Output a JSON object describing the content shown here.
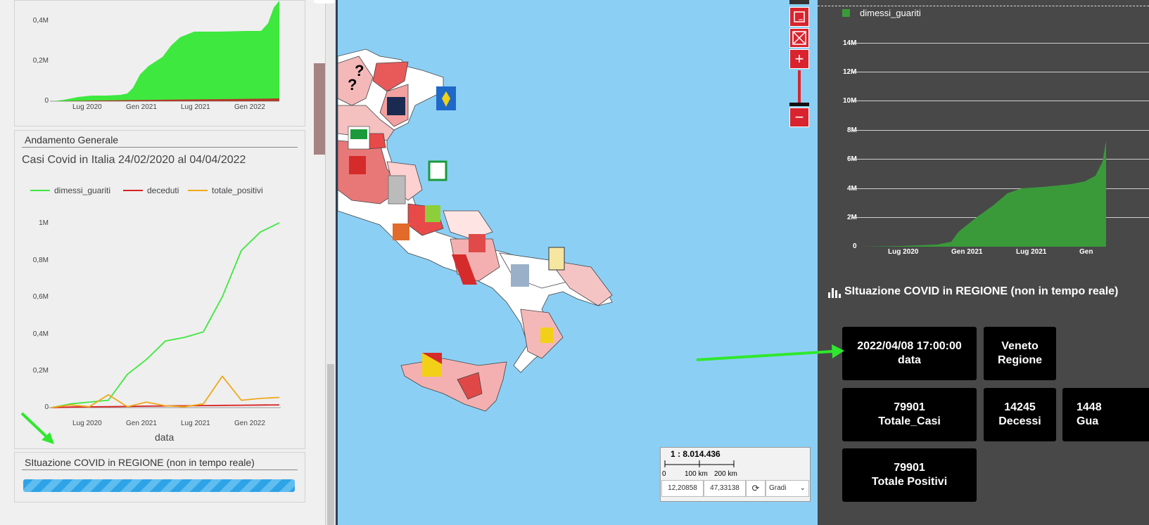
{
  "left": {
    "top_chart": {
      "yticks": [
        "0,4M",
        "0,2M",
        "0"
      ],
      "xticks": [
        "Lug 2020",
        "Gen 2021",
        "Lug 2021",
        "Gen 2022"
      ]
    },
    "general_card": {
      "title": "Andamento Generale",
      "chart_title": "Casi Covid in Italia 24/02/2020 al 04/04/2022"
    },
    "region_card": {
      "title": "SItuazione COVID in REGIONE (non in tempo reale)"
    }
  },
  "chart_data": [
    {
      "type": "area",
      "x": [
        "2020-02",
        "2020-07",
        "2021-01",
        "2021-07",
        "2022-01",
        "2022-04"
      ],
      "series": [
        {
          "name": "",
          "values": [
            0,
            15000,
            110000,
            170000,
            250000,
            500000
          ]
        },
        {
          "name": "",
          "values": [
            0,
            2000,
            3000,
            4000,
            5000,
            6000
          ]
        }
      ],
      "yticks": [
        "0",
        "0,2M",
        "0,4M"
      ],
      "xticks": [
        "Lug 2020",
        "Gen 2021",
        "Lug 2021",
        "Gen 2022"
      ]
    },
    {
      "type": "line",
      "title": "Casi Covid in Italia 24/02/2020 al 04/04/2022",
      "xlabel": "data",
      "ylabel": "",
      "ylim": [
        0,
        1000000
      ],
      "x": [
        "2020-02",
        "2020-05",
        "2020-08",
        "2020-10",
        "2020-12",
        "2021-03",
        "2021-06",
        "2021-09",
        "2021-12",
        "2022-01",
        "2022-02",
        "2022-03",
        "2022-04"
      ],
      "series": [
        {
          "name": "dimessi_guariti",
          "values": [
            0,
            20000,
            30000,
            40000,
            180000,
            260000,
            360000,
            380000,
            410000,
            600000,
            850000,
            950000,
            1000000
          ]
        },
        {
          "name": "deceduti",
          "values": [
            0,
            3000,
            4000,
            5000,
            6000,
            8000,
            9000,
            10000,
            11000,
            12000,
            13000,
            14000,
            15000
          ]
        },
        {
          "name": "totale_positivi",
          "values": [
            0,
            15000,
            5000,
            70000,
            5000,
            30000,
            10000,
            5000,
            20000,
            170000,
            40000,
            50000,
            55000
          ]
        }
      ],
      "yticks": [
        "0",
        "0,2M",
        "0,4M",
        "0,6M",
        "0,8M",
        "1M"
      ],
      "xticks": [
        "Lug 2020",
        "Gen 2021",
        "Lug 2021",
        "Gen 2022"
      ]
    },
    {
      "type": "area",
      "legend": [
        "dimessi_guariti"
      ],
      "x": [
        "2020-02",
        "2020-07",
        "2021-01",
        "2021-07",
        "2022-01",
        "2022-04"
      ],
      "series": [
        {
          "name": "dimessi_guariti",
          "values": [
            0,
            200000,
            1200000,
            4000000,
            4700000,
            7000000
          ]
        }
      ],
      "yticks": [
        "0",
        "2M",
        "4M",
        "6M",
        "8M",
        "10M",
        "12M",
        "14M"
      ],
      "xticks": [
        "Lug 2020",
        "Gen 2021",
        "Lug 2021",
        "Gen"
      ],
      "colors": [
        "#3a9a3a"
      ]
    }
  ],
  "map": {
    "scale_label": "1 : 8.014.436",
    "scale_ticks": [
      "0",
      "100 km",
      "200 km"
    ],
    "coord_x": "12,20858",
    "coord_y": "47,33138",
    "units_select": "Gradi",
    "zoom_plus": "+",
    "zoom_minus": "−",
    "unknown_marks": [
      "?",
      "?"
    ]
  },
  "right": {
    "legend_label": "dimessi_guariti",
    "section_title": "SItuazione COVID in REGIONE (non in tempo reale)",
    "tiles": [
      {
        "value": "2022/04/08 17:00:00",
        "label": "data"
      },
      {
        "value": "Veneto",
        "label": "Regione"
      },
      {
        "value": "79901",
        "label": "Totale_Casi"
      },
      {
        "value": "14245",
        "label": "Decessi"
      },
      {
        "value": "1448",
        "label": "Gua"
      },
      {
        "value": "79901",
        "label": "Totale Positivi"
      }
    ]
  },
  "colors": {
    "accent_red": "#d9232e",
    "recovered_green": "#3ee83e",
    "deaths_red": "#d82020",
    "positives_orange": "#f0a818",
    "progress_blue": "#2ea3e6"
  }
}
